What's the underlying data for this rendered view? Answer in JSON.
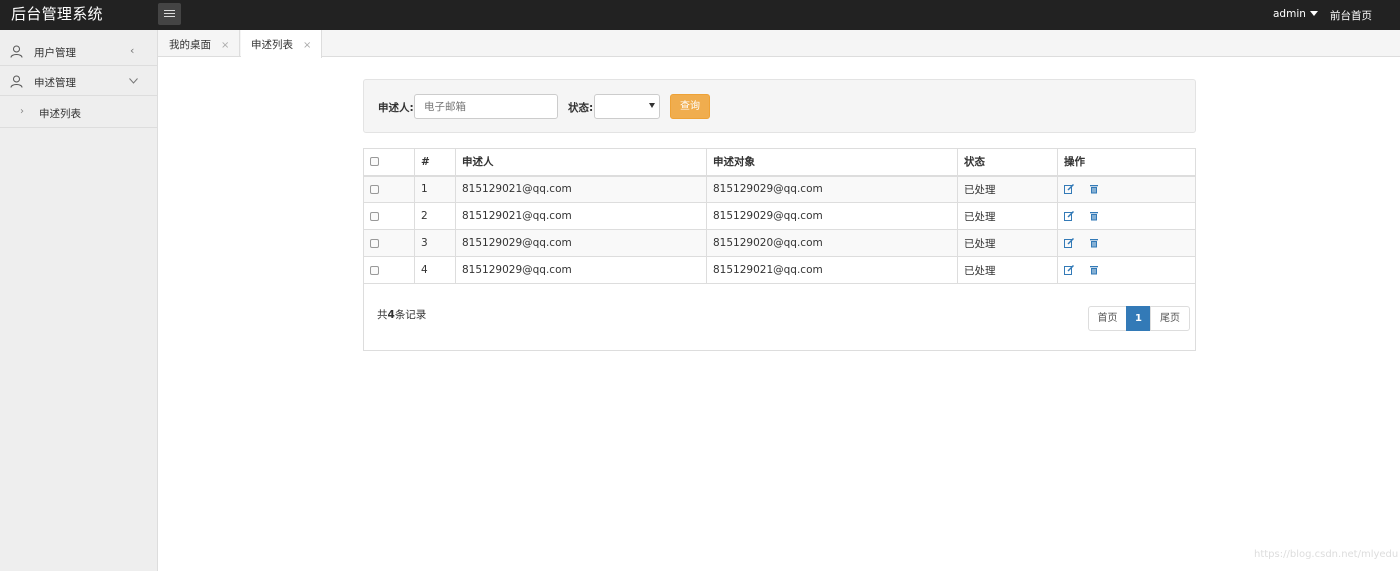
{
  "app": {
    "title": "后台管理系统"
  },
  "topnav": {
    "user": "admin",
    "home_link": "前台首页"
  },
  "sidebar": {
    "items": [
      {
        "label": "用户管理",
        "icon": "user-icon",
        "chevron": "chevron-left-icon"
      },
      {
        "label": "申述管理",
        "icon": "user-icon",
        "chevron": "chevron-down-icon"
      }
    ],
    "sub_items": [
      {
        "label": "申述列表",
        "icon": "chevron-right-icon"
      }
    ]
  },
  "tabs": [
    {
      "label": "我的桌面",
      "close": "×"
    },
    {
      "label": "申述列表",
      "close": "×",
      "active": true
    }
  ],
  "search": {
    "appellant_label": "申述人:",
    "appellant_placeholder": "电子邮箱",
    "status_label": "状态:",
    "status_value": "",
    "query_button": "查询"
  },
  "table": {
    "headers": [
      "",
      "#",
      "申述人",
      "申述对象",
      "状态",
      "操作"
    ],
    "rows": [
      {
        "id": "1",
        "appellant": "815129021@qq.com",
        "target": "815129029@qq.com",
        "status": "已处理"
      },
      {
        "id": "2",
        "appellant": "815129021@qq.com",
        "target": "815129029@qq.com",
        "status": "已处理"
      },
      {
        "id": "3",
        "appellant": "815129029@qq.com",
        "target": "815129020@qq.com",
        "status": "已处理"
      },
      {
        "id": "4",
        "appellant": "815129029@qq.com",
        "target": "815129021@qq.com",
        "status": "已处理"
      }
    ]
  },
  "footer": {
    "total_prefix": "共",
    "total_count": "4",
    "total_suffix": "条记录"
  },
  "pagination": {
    "first": "首页",
    "current": "1",
    "last": "尾页"
  },
  "watermark": "https://blog.csdn.net/mlyedu",
  "colors": {
    "topbar": "#222222",
    "accent": "#337ab7",
    "query_button": "#f0ad4e"
  }
}
